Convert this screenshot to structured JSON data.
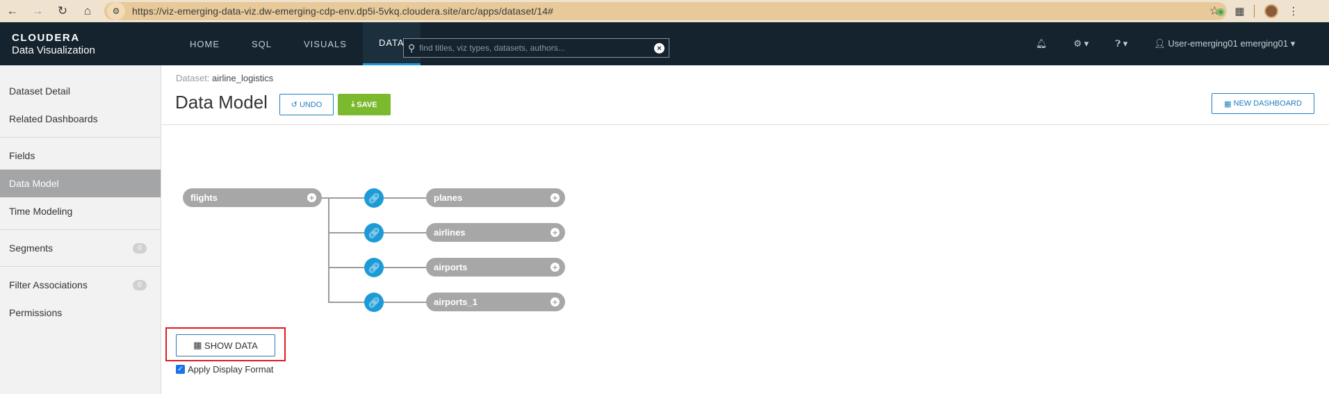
{
  "browser": {
    "url": "https://viz-emerging-data-viz.dw-emerging-cdp-env.dp5i-5vkq.cloudera.site/arc/apps/dataset/14#"
  },
  "header": {
    "logo_top": "CLOUDERA",
    "logo_bottom": "Data Visualization",
    "nav": [
      "HOME",
      "SQL",
      "VISUALS",
      "DATA"
    ],
    "active_nav": "DATA",
    "search_placeholder": "find titles, viz types, datasets, authors...",
    "user": "User-emerging01 emerging01"
  },
  "sidebar": {
    "items": [
      {
        "label": "Dataset Detail"
      },
      {
        "label": "Related Dashboards"
      },
      {
        "label": "Fields"
      },
      {
        "label": "Data Model"
      },
      {
        "label": "Time Modeling"
      },
      {
        "label": "Segments",
        "badge": "0"
      },
      {
        "label": "Filter Associations",
        "badge": "0"
      },
      {
        "label": "Permissions"
      }
    ]
  },
  "main": {
    "breadcrumb_label": "Dataset:",
    "breadcrumb_value": "airline_logistics",
    "title": "Data Model",
    "undo_label": "UNDO",
    "save_label": "SAVE",
    "new_dashboard_label": "NEW DASHBOARD",
    "show_data_label": "SHOW DATA",
    "apply_format_label": "Apply Display Format",
    "apply_format_checked": true
  },
  "model": {
    "root": "flights",
    "joins": [
      "planes",
      "airlines",
      "airports",
      "airports_1"
    ]
  },
  "colors": {
    "header_bg": "#14232e",
    "accent": "#1d9bd7",
    "save_green": "#7bba2e",
    "pill_grey": "#a7a7a7",
    "highlight_red": "#e0191e"
  }
}
